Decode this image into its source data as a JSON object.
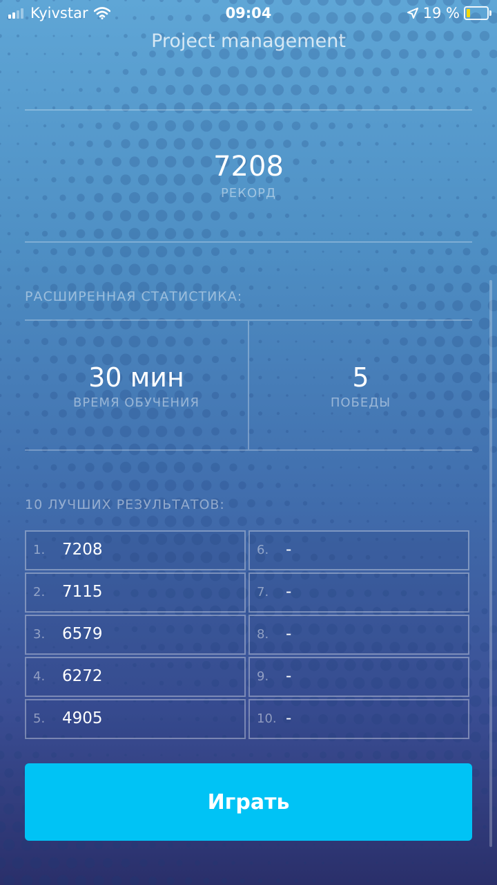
{
  "status_bar": {
    "carrier": "Kyivstar",
    "time": "09:04",
    "battery_percent": "19 %",
    "battery_level": 0.19,
    "signal_icon": "signal-bars-icon",
    "wifi_icon": "wifi-icon",
    "location_icon": "location-arrow-icon",
    "battery_icon": "battery-charging-icon"
  },
  "header": {
    "title": "Project management"
  },
  "record": {
    "value": "7208",
    "label": "РЕКОРД"
  },
  "extended_stats": {
    "title": "РАСШИРЕННАЯ СТАТИСТИКА:",
    "items": [
      {
        "value": "30 мин",
        "label": "ВРЕМЯ ОБУЧЕНИЯ"
      },
      {
        "value": "5",
        "label": "ПОБЕДЫ"
      }
    ]
  },
  "top_results": {
    "title": "10 ЛУЧШИХ РЕЗУЛЬТАТОВ:",
    "items": [
      {
        "rank": "1.",
        "score": "7208"
      },
      {
        "rank": "2.",
        "score": "7115"
      },
      {
        "rank": "3.",
        "score": "6579"
      },
      {
        "rank": "4.",
        "score": "6272"
      },
      {
        "rank": "5.",
        "score": "4905"
      },
      {
        "rank": "6.",
        "score": "-"
      },
      {
        "rank": "7.",
        "score": "-"
      },
      {
        "rank": "8.",
        "score": "-"
      },
      {
        "rank": "9.",
        "score": "-"
      },
      {
        "rank": "10.",
        "score": "-"
      }
    ]
  },
  "play_button": {
    "label": "Играть"
  },
  "colors": {
    "accent": "#00c3f5",
    "battery_fill": "#f5d90a"
  }
}
